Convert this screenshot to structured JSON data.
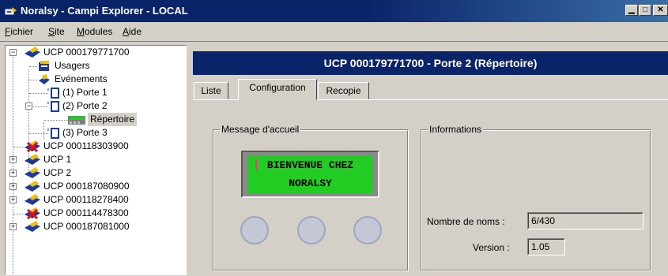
{
  "window": {
    "title": "Noralsy - Campi Explorer - LOCAL",
    "controls": [
      "minimize",
      "maximize",
      "close"
    ]
  },
  "menu": {
    "items": [
      {
        "label": "Fichier",
        "accel": "F"
      },
      {
        "label": "Site",
        "accel": "S"
      },
      {
        "label": "Modules",
        "accel": "M"
      },
      {
        "label": "Aide",
        "accel": "A"
      }
    ]
  },
  "tree": {
    "nodes": [
      {
        "label": "UCP 000179771700",
        "icon": "controller-icon",
        "expander": "minus"
      },
      {
        "label": "Usagers",
        "icon": "users-book-icon"
      },
      {
        "label": "Evénements",
        "icon": "events-icon"
      },
      {
        "label": "(1) Porte 1",
        "icon": "door-icon"
      },
      {
        "label": "(2) Porte 2",
        "icon": "door-icon",
        "expander": "minus"
      },
      {
        "label": "Répertoire",
        "icon": "keypad-icon",
        "selected": true
      },
      {
        "label": "(3) Porte 3",
        "icon": "door-icon"
      },
      {
        "label": "UCP 000118303900",
        "icon": "controller-error-icon"
      },
      {
        "label": "UCP 1",
        "icon": "controller-icon",
        "expander": "plus"
      },
      {
        "label": "UCP 2",
        "icon": "controller-icon",
        "expander": "plus"
      },
      {
        "label": "UCP 000187080900",
        "icon": "controller-icon",
        "expander": "plus"
      },
      {
        "label": "UCP 000118278400",
        "icon": "controller-icon",
        "expander": "plus"
      },
      {
        "label": "UCP 000114478300",
        "icon": "controller-error-icon"
      },
      {
        "label": "UCP 000187081000",
        "icon": "controller-icon",
        "expander": "plus"
      }
    ]
  },
  "panel": {
    "header": "UCP 000179771700 - Porte 2 (Répertoire)",
    "tabs": [
      {
        "label": "Liste"
      },
      {
        "label": "Configuration",
        "active": true
      },
      {
        "label": "Recopie"
      }
    ],
    "welcome": {
      "title": "Message d'accueil",
      "lcd_line1": "BIENVENUE CHEZ",
      "lcd_line2": "NORALSY"
    },
    "info": {
      "title": "Informations",
      "names_label": "Nombre de noms :",
      "names_value": "6/430",
      "version_label": "Version :",
      "version_value": "1.05"
    }
  },
  "colors": {
    "titlebar": "#0a246a",
    "header": "#0a246a",
    "lcd": "#22cc22",
    "face": "#d4d0c8"
  }
}
